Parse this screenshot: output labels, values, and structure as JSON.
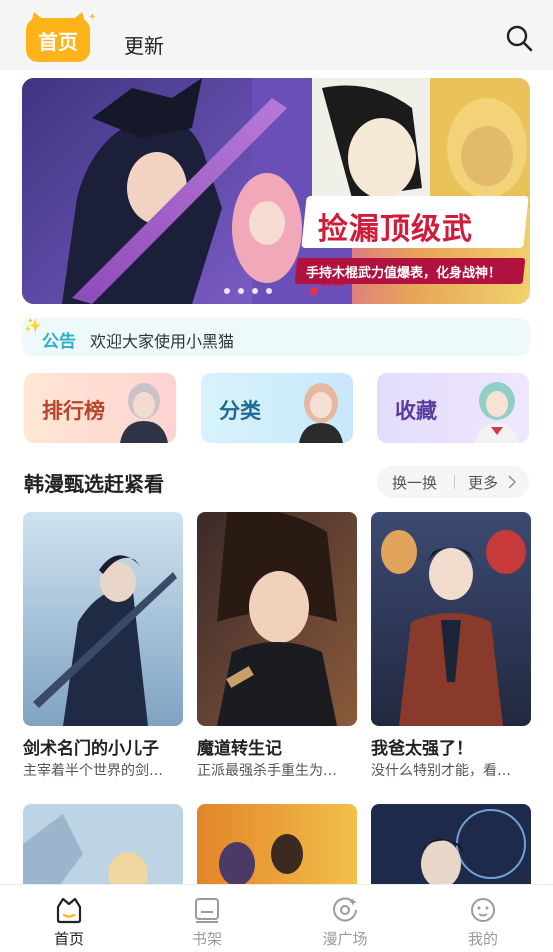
{
  "header": {
    "tab_home": "首页",
    "tab_update": "更新"
  },
  "banner": {
    "title": "捡漏顶级武器！",
    "subtitle": "手持木棍武力值爆表，化身战神！",
    "slide_count": 5,
    "active_slide": 5
  },
  "notice": {
    "tag": "公告",
    "text": "欢迎大家使用小黑猫"
  },
  "quick_entries": [
    {
      "label": "排行榜"
    },
    {
      "label": "分类"
    },
    {
      "label": "收藏"
    }
  ],
  "section": {
    "title": "韩漫甄选赶紧看",
    "swap_label": "换一换",
    "more_label": "更多"
  },
  "comics": [
    {
      "title": "剑术名门的小儿子",
      "desc": "主宰着半个世界的剑…"
    },
    {
      "title": "魔道转生记",
      "desc": "正派最强杀手重生为…"
    },
    {
      "title": "我爸太强了！",
      "desc": "没什么特别才能，看…"
    }
  ],
  "bottom_nav": [
    {
      "label": "首页",
      "icon": "home-icon",
      "active": true
    },
    {
      "label": "书架",
      "icon": "bookshelf-icon",
      "active": false
    },
    {
      "label": "漫广场",
      "icon": "plaza-icon",
      "active": false
    },
    {
      "label": "我的",
      "icon": "profile-icon",
      "active": false
    }
  ],
  "colors": {
    "accent": "#ffb31a",
    "notice_tag": "#2bb0c6",
    "banner_title": "#d01c3a"
  }
}
